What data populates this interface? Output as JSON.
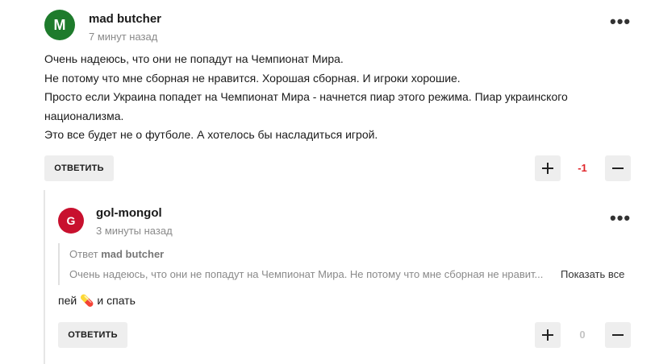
{
  "comment1": {
    "avatar_letter": "M",
    "avatar_color": "#1e7b2c",
    "author": "mad butcher",
    "time": "7 минут назад",
    "lines": [
      "Очень надеюсь, что они не попадут на Чемпионат Мира.",
      "Не потому что мне сборная не нравится. Хорошая сборная. И игроки хорошие.",
      "Просто если Украина попадет на Чемпионат Мира - начнется пиар этого режима. Пиар украинского",
      "национализма.",
      "Это все будет не о футболе. А хотелось бы насладиться игрой."
    ],
    "reply_label": "ОТВЕТИТЬ",
    "score": "-1",
    "score_color": "#e0262b",
    "upvote_icon": "plus-icon",
    "downvote_icon": "minus-icon"
  },
  "comment2": {
    "avatar_letter": "G",
    "avatar_color": "#c8102e",
    "author": "gol-mongol",
    "time": "3 минуты назад",
    "quote_prefix": "Ответ",
    "quote_author": "mad butcher",
    "quote_text": "Очень надеюсь, что они не попадут на Чемпионат Мира. Не потому что мне сборная не нравит...",
    "show_all": "Показать все",
    "body_before": "пей",
    "body_emoji": "💊",
    "body_after": "и спать",
    "reply_label": "ОТВЕТИТЬ",
    "score": "0",
    "score_color": "#c4c4c4"
  }
}
